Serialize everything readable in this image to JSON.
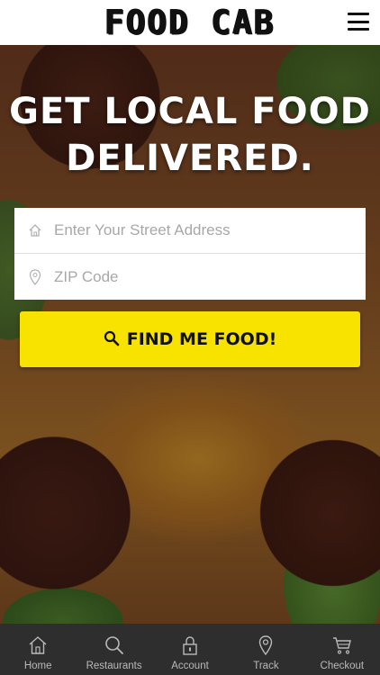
{
  "header": {
    "logo_text": "FOOD CAB"
  },
  "hero": {
    "headline_line1": "GET LOCAL FOOD",
    "headline_line2": "DELIVERED."
  },
  "form": {
    "address_placeholder": "Enter Your Street Address",
    "zip_placeholder": "ZIP Code",
    "address_value": "",
    "zip_value": ""
  },
  "cta": {
    "label": "FIND ME FOOD!"
  },
  "nav": {
    "items": [
      {
        "label": "Home",
        "icon": "home-icon"
      },
      {
        "label": "Restaurants",
        "icon": "search-icon"
      },
      {
        "label": "Account",
        "icon": "lock-icon"
      },
      {
        "label": "Track",
        "icon": "location-pin-icon"
      },
      {
        "label": "Checkout",
        "icon": "cart-icon"
      }
    ]
  },
  "colors": {
    "accent": "#f7e200",
    "nav_bg": "#2e2e2e",
    "header_bg": "#ffffff"
  }
}
